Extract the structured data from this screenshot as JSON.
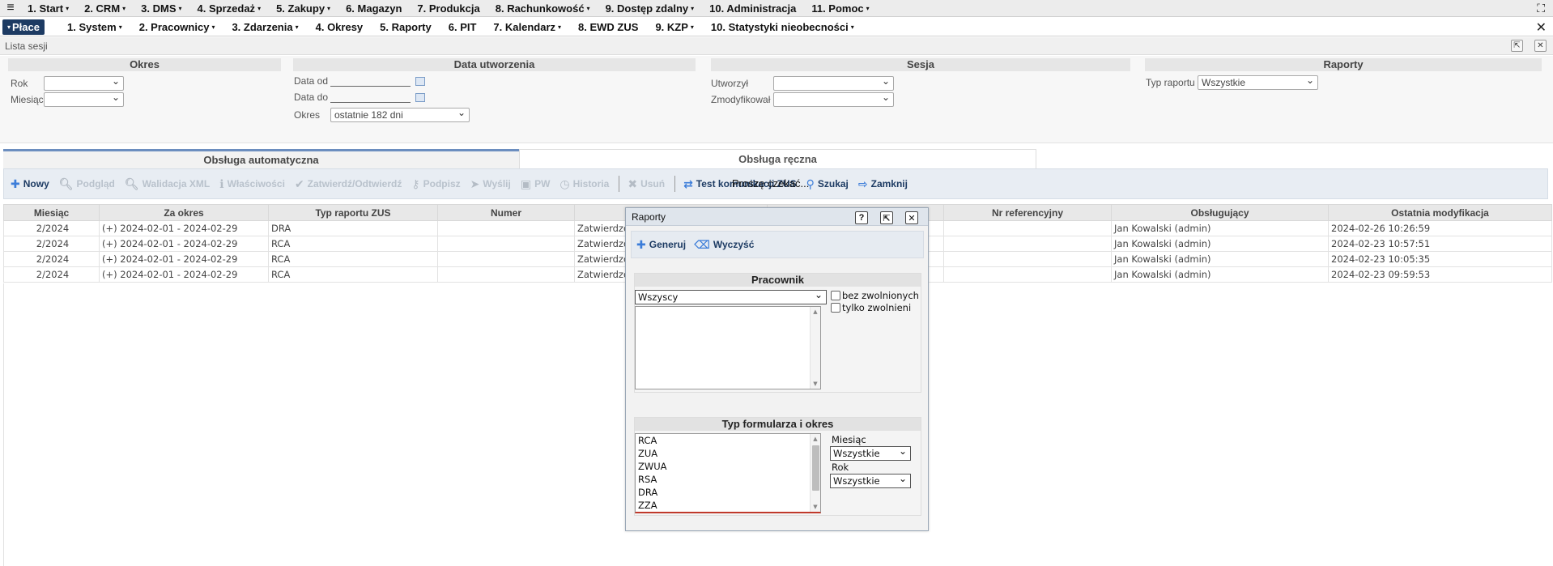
{
  "menubar": {
    "items": [
      "1. Start",
      "2. CRM",
      "3. DMS",
      "4. Sprzedaż",
      "5. Zakupy",
      "6. Magazyn",
      "7. Produkcja",
      "8. Rachunkowość",
      "9. Dostęp zdalny",
      "10. Administracja",
      "11. Pomoc"
    ],
    "carets": [
      true,
      true,
      true,
      true,
      true,
      false,
      false,
      true,
      true,
      false,
      true
    ]
  },
  "submenu": {
    "active": "Płace",
    "items": [
      "1. System",
      "2. Pracownicy",
      "3. Zdarzenia",
      "4. Okresy",
      "5. Raporty",
      "6. PIT",
      "7. Kalendarz",
      "8. EWD ZUS",
      "9. KZP",
      "10. Statystyki nieobecności"
    ],
    "carets": [
      true,
      true,
      true,
      false,
      false,
      false,
      true,
      false,
      true,
      true
    ]
  },
  "window": {
    "title": "Lista sesji"
  },
  "filters": {
    "okres": {
      "header": "Okres",
      "rok_label": "Rok",
      "miesiac_label": "Miesiąc"
    },
    "data_utworzenia": {
      "header": "Data utworzenia",
      "data_od_label": "Data od",
      "data_do_label": "Data do",
      "okres_label": "Okres",
      "okres_value": "ostatnie 182 dni"
    },
    "sesja": {
      "header": "Sesja",
      "utworzyl_label": "Utworzył",
      "zmodyfikowal_label": "Zmodyfikował"
    },
    "raporty": {
      "header": "Raporty",
      "typ_label": "Typ raportu",
      "typ_value": "Wszystkie"
    }
  },
  "tabs": {
    "auto": "Obsługa automatyczna",
    "manual": "Obsługa ręczna"
  },
  "toolbar": {
    "nowy": "Nowy",
    "podglad": "Podgląd",
    "walidacja": "Walidacja XML",
    "wlasciwosci": "Właściwości",
    "zatwierdz": "Zatwierdź/Odtwierdź",
    "podpisz": "Podpisz",
    "wyslij": "Wyślij",
    "pw": "PW",
    "historia": "Historia",
    "usun": "Usuń",
    "test": "Test komunikacji ZUS",
    "szukaj": "Szukaj",
    "zamknij": "Zamknij",
    "overlay": "Proszę czekać..."
  },
  "grid": {
    "columns": [
      "Miesiąc",
      "Za okres",
      "Typ raportu ZUS",
      "Numer",
      "",
      "",
      "Nr referencyjny",
      "Obsługujący",
      "Ostatnia modyfikacja"
    ],
    "rows": [
      [
        "2/2024",
        "(+) 2024-02-01 - 2024-02-29",
        "DRA",
        "",
        "Zatwierdzo",
        "",
        "",
        "Jan Kowalski (admin)",
        "2024-02-26 10:26:59"
      ],
      [
        "2/2024",
        "(+) 2024-02-01 - 2024-02-29",
        "RCA",
        "",
        "Zatwierdzo",
        "",
        "",
        "Jan Kowalski (admin)",
        "2024-02-23 10:57:51"
      ],
      [
        "2/2024",
        "(+) 2024-02-01 - 2024-02-29",
        "RCA",
        "",
        "Zatwierdzo",
        "",
        "",
        "Jan Kowalski (admin)",
        "2024-02-23 10:05:35"
      ],
      [
        "2/2024",
        "(+) 2024-02-01 - 2024-02-29",
        "RCA",
        "",
        "Zatwierdzo",
        "",
        "",
        "Jan Kowalski (admin)",
        "2024-02-23 09:59:53"
      ]
    ]
  },
  "dialog": {
    "title": "Raporty",
    "help": "?",
    "generuj": "Generuj",
    "wyczysc": "Wyczyść",
    "pracownik": {
      "header": "Pracownik",
      "select_value": "Wszyscy",
      "bez_zwolnionych": "bez zwolnionych",
      "tylko_zwolnieni": "tylko zwolnieni"
    },
    "typ_formularza": {
      "header": "Typ formularza i okres",
      "items": [
        "RCA",
        "ZUA",
        "ZWUA",
        "RSA",
        "DRA",
        "ZZA"
      ],
      "miesiac_label": "Miesiąc",
      "miesiac_value": "Wszystkie",
      "rok_label": "Rok",
      "rok_value": "Wszystkie"
    }
  }
}
